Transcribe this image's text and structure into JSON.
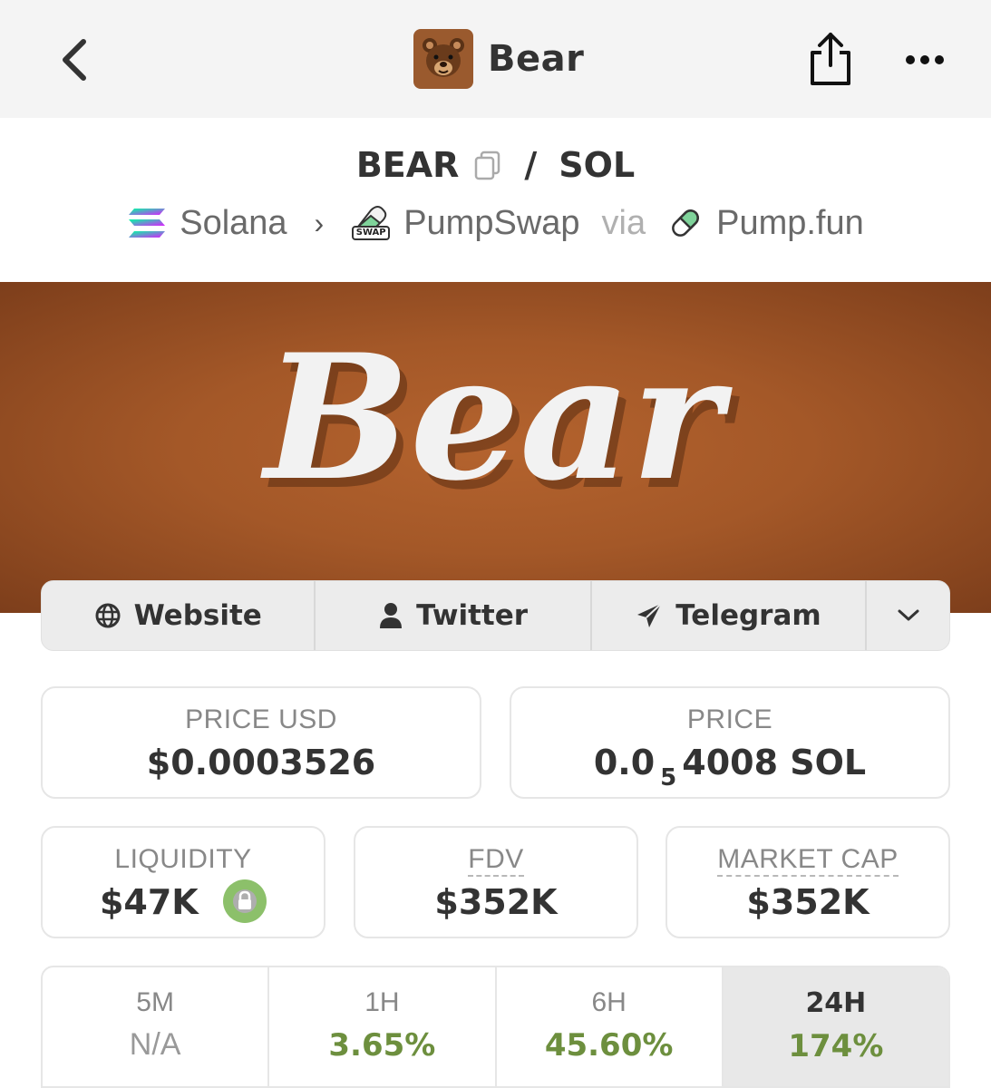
{
  "nav": {
    "title": "Bear"
  },
  "pair": {
    "base": "BEAR",
    "separator": "/",
    "quote": "SOL"
  },
  "chain": {
    "network": "Solana",
    "dex": "PumpSwap",
    "dex_badge": "SWAP",
    "via_label": "via",
    "launchpad": "Pump.fun"
  },
  "banner": {
    "logo_text": "Bear"
  },
  "links": {
    "website": "Website",
    "twitter": "Twitter",
    "telegram": "Telegram"
  },
  "stats": {
    "price_usd_label": "PRICE USD",
    "price_usd_value": "$0.0003526",
    "price_label": "PRICE",
    "price_prefix": "0.0",
    "price_zero_count": "5",
    "price_suffix": "4008 SOL",
    "liquidity_label": "LIQUIDITY",
    "liquidity_value": "$47K",
    "fdv_label": "FDV",
    "fdv_value": "$352K",
    "mcap_label": "MARKET CAP",
    "mcap_value": "$352K"
  },
  "timeframes": [
    {
      "label": "5M",
      "value": "N/A"
    },
    {
      "label": "1H",
      "value": "3.65%"
    },
    {
      "label": "6H",
      "value": "45.60%"
    },
    {
      "label": "24H",
      "value": "174%"
    }
  ],
  "colors": {
    "positive": "#6d8f3e",
    "lock_green": "#8cc06a",
    "banner_brown": "#a45828"
  }
}
